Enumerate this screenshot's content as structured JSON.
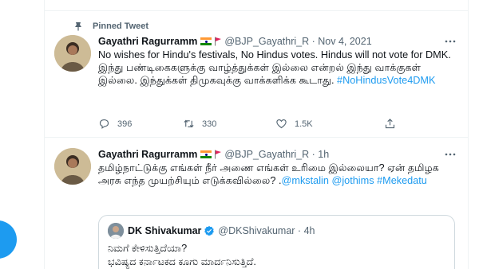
{
  "pinned_label": "Pinned Tweet",
  "tweets": [
    {
      "display_name": "Gayathri Ragurramm",
      "handle_meta": "@BJP_Gayathri_R · Nov 4, 2021",
      "text": "No wishes for Hindu's festivals, No Hindus votes. Hindus will not vote for DMK. இந்து பண்டிகைகளுக்கு வாழ்த்துக்கள் இல்லை என்றல் இந்து வாக்குகள் இல்லை. இந்துக்கள் திமுகவுக்கு வாக்களிக்க கூடாது.",
      "hashtag": "#NoHindusVote4DMK",
      "actions": {
        "replies": "396",
        "retweets": "330",
        "likes": "1.5K"
      }
    },
    {
      "display_name": "Gayathri Ragurramm",
      "handle_meta": "@BJP_Gayathri_R · 1h",
      "text": "தமிழ்நாட்டுக்கு எங்கள் நீர் அணை எங்கள் உரிமை இல்லையா? ஏன் தமிழக அரசு எந்த முயற்சியும் எடுக்கவில்லை?  .",
      "mentions": [
        "@mkstalin",
        "@jothims",
        "#Mekedatu"
      ],
      "quote": {
        "display_name": "DK Shivakumar",
        "handle_meta": "@DKShivakumar · 4h",
        "line1": "ನಿಮಗೆ ಕೇಳಿಸುತ್ತಿದೆಯಾ?",
        "line2": "ಭವಿಷ್ಯದ ಕರ್ನಾಟಕದ ಕೂಗು ಮಾರ್ದನಿಸುತ್ತಿದೆ."
      }
    }
  ],
  "colors": {
    "accent": "#1d9bf0",
    "secondary_text": "#536471",
    "border": "#eff3f4"
  },
  "icons": [
    "pin-icon",
    "more-icon",
    "reply-icon",
    "retweet-icon",
    "like-icon",
    "share-icon",
    "verified-icon"
  ]
}
